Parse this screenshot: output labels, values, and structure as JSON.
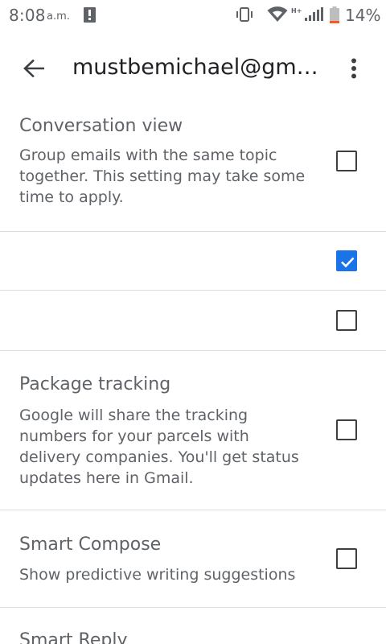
{
  "status_bar": {
    "time": "8:08",
    "ampm": "a.m.",
    "network_type": "H+",
    "battery_percent": "14%",
    "icons": [
      "alert-icon",
      "vibrate-icon",
      "wifi-icon",
      "signal-icon",
      "battery-icon"
    ]
  },
  "app_bar": {
    "title": "mustbemichael@gm…",
    "back_icon": "arrow-back-icon",
    "overflow_icon": "more-vert-icon"
  },
  "settings": {
    "conversation_view": {
      "title": "Conversation view",
      "description": "Group emails with the same topic together. This setting may take some time to apply.",
      "checked": false
    },
    "row_2": {
      "checked": true
    },
    "row_3": {
      "checked": false
    },
    "package_tracking": {
      "title": "Package tracking",
      "description": "Google will share the tracking numbers for your parcels with delivery companies. You'll get status updates here in Gmail.",
      "checked": false
    },
    "smart_compose": {
      "title": "Smart Compose",
      "description": "Show predictive writing suggestions",
      "checked": false
    },
    "smart_reply": {
      "title": "Smart Reply"
    }
  },
  "colors": {
    "accent": "#1a73e8",
    "text_secondary": "#5f6368",
    "divider": "#dadce0"
  }
}
